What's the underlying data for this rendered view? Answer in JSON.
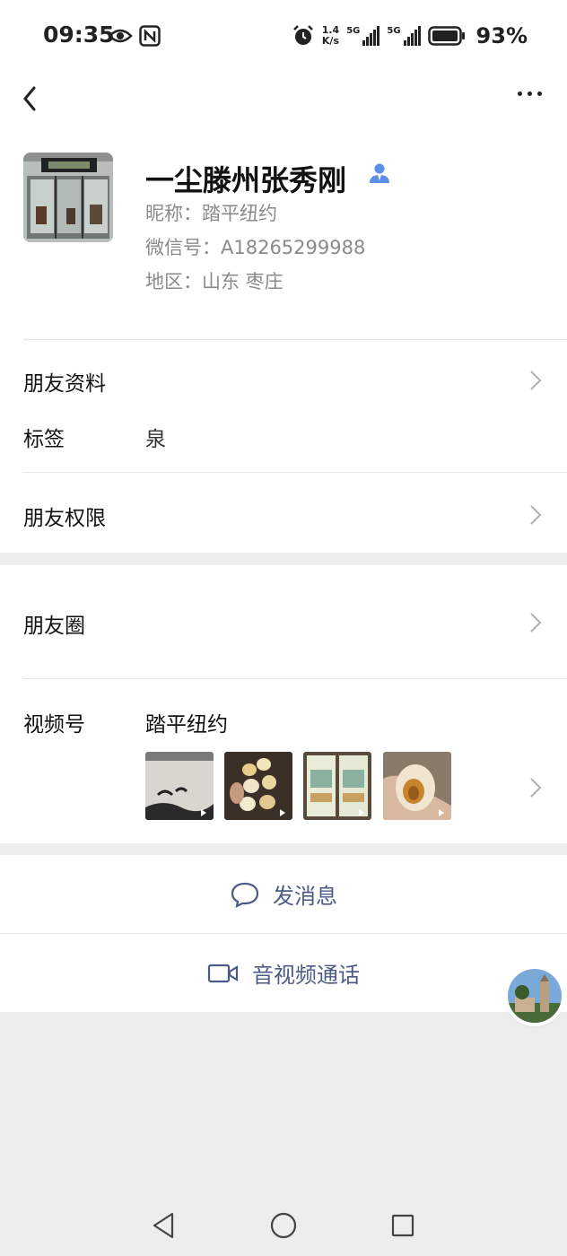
{
  "status_bar": {
    "time": "09:35",
    "speed_value": "1.4",
    "speed_unit": "K/s",
    "network_1": "5G",
    "network_2": "5G",
    "battery": "93%"
  },
  "profile": {
    "display_name": "一尘滕州张秀刚",
    "nickname": "昵称：踏平纽约",
    "wechat_id": "微信号：A18265299988",
    "region": "地区：山东  枣庄"
  },
  "rows": {
    "friend_info_label": "朋友资料",
    "tags_label": "标签",
    "tags_value": "泉",
    "permissions_label": "朋友权限",
    "moments_label": "朋友圈",
    "channels_label": "视频号",
    "channels_value": "踏平纽约"
  },
  "actions": {
    "message_label": "发消息",
    "call_label": "音视频通话"
  },
  "colors": {
    "action_text": "#4b5b85",
    "accent_blue": "#5b8ee6"
  }
}
